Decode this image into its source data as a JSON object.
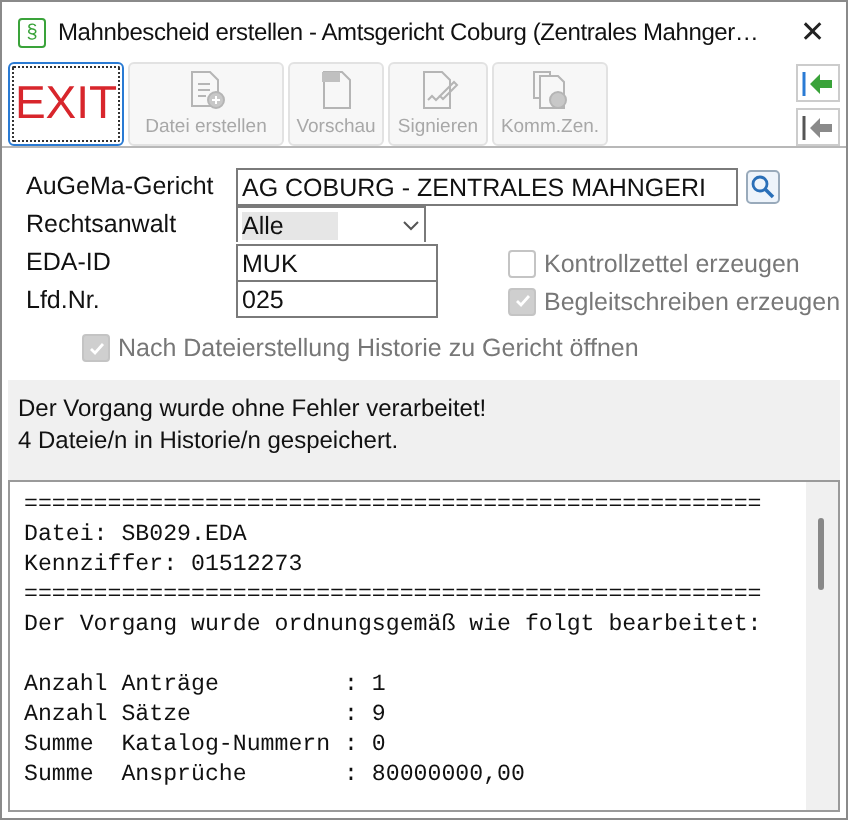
{
  "window": {
    "app_icon": "§",
    "title": "Mahnbescheid erstellen - Amtsgericht Coburg (Zentrales Mahnger…",
    "close": "✕"
  },
  "toolbar": [
    {
      "kind": "exit",
      "label": "EXIT",
      "disabled": false,
      "selected": true
    },
    {
      "kind": "file",
      "label": "Datei erstellen",
      "disabled": true,
      "selected": false
    },
    {
      "kind": "preview",
      "label": "Vorschau",
      "disabled": true,
      "selected": false
    },
    {
      "kind": "sign",
      "label": "Signieren",
      "disabled": true,
      "selected": false
    },
    {
      "kind": "comm",
      "label": "Komm.Zen.",
      "disabled": true,
      "selected": false
    }
  ],
  "form": {
    "court_label": "AuGeMa-Gericht",
    "court_value": "AG COBURG - ZENTRALES MAHNGERI",
    "lawyer_label": "Rechtsanwalt",
    "lawyer_value": "Alle",
    "eda_label": "EDA-ID",
    "eda_value": "MUK",
    "lfd_label": "Lfd.Nr.",
    "lfd_value": "025",
    "checkboxes": [
      {
        "label": "Kontrollzettel erzeugen",
        "checked": false,
        "disabled": true
      },
      {
        "label": "Begleitschreiben erzeugen",
        "checked": true,
        "disabled": true
      }
    ],
    "history": {
      "label": "Nach Dateierstellung Historie zu Gericht öffnen",
      "checked": true,
      "disabled": true
    }
  },
  "message": [
    "Der Vorgang wurde ohne Fehler verarbeitet!",
    "4 Dateie/n in Historie/n gespeichert."
  ],
  "log": [
    {
      "kind": "text",
      "text": "====================================================="
    },
    {
      "kind": "text",
      "text": "Datei: SB029.EDA"
    },
    {
      "kind": "text",
      "text": "Kennziffer: 01512273"
    },
    {
      "kind": "text",
      "text": "====================================================="
    },
    {
      "kind": "text",
      "text": "Der Vorgang wurde ordnungsgemäß wie folgt bearbeitet:"
    },
    {
      "kind": "blank"
    },
    {
      "kind": "text",
      "text": "Anzahl Anträge         : 1"
    },
    {
      "kind": "text",
      "text": "Anzahl Sätze           : 9"
    },
    {
      "kind": "text",
      "text": "Summe  Katalog-Nummern : 0"
    },
    {
      "kind": "text",
      "text": "Summe  Ansprüche       : 80000000,00"
    }
  ]
}
